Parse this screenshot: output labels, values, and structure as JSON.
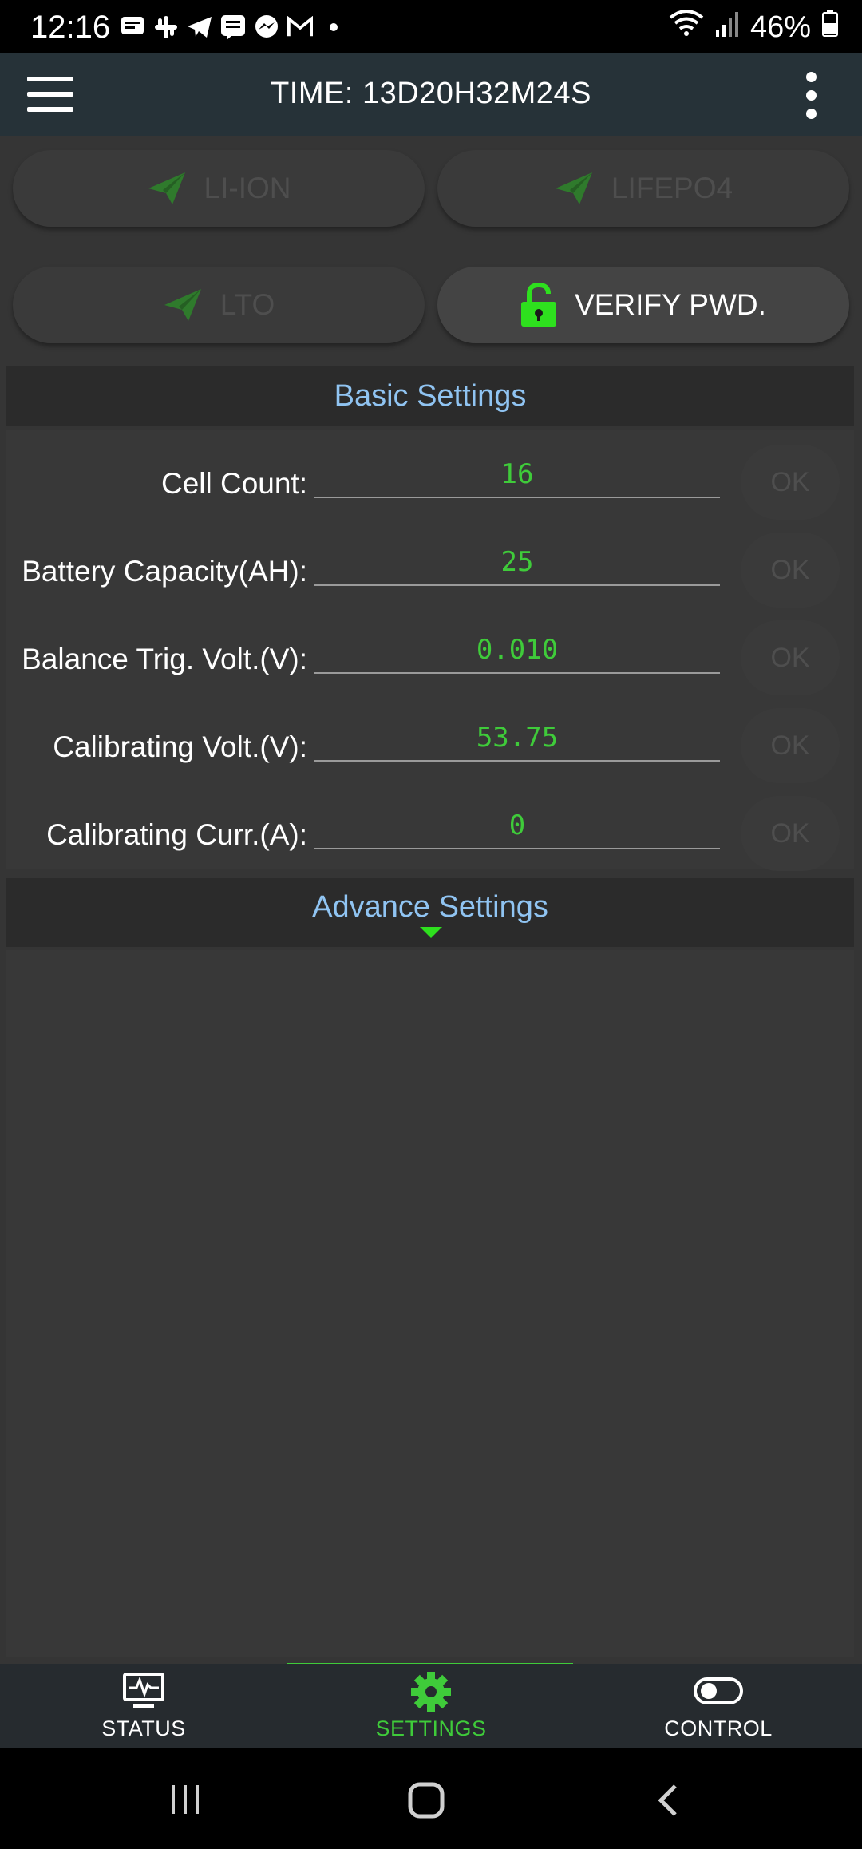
{
  "status_bar": {
    "time": "12:16",
    "battery_percent": "46%"
  },
  "app_bar": {
    "title": "TIME: 13D20H32M24S"
  },
  "presets": [
    {
      "label": "LI-ION"
    },
    {
      "label": "LIFEPO4"
    },
    {
      "label": "LTO"
    },
    {
      "label": "VERIFY PWD."
    }
  ],
  "basic_settings": {
    "header": "Basic Settings",
    "rows": [
      {
        "label": "Cell Count:",
        "value": "16",
        "ok": "OK"
      },
      {
        "label": "Battery Capacity(AH):",
        "value": "25",
        "ok": "OK"
      },
      {
        "label": "Balance Trig. Volt.(V):",
        "value": "0.010",
        "ok": "OK"
      },
      {
        "label": "Calibrating Volt.(V):",
        "value": "53.75",
        "ok": "OK"
      },
      {
        "label": "Calibrating Curr.(A):",
        "value": "0",
        "ok": "OK"
      }
    ]
  },
  "advance_settings": {
    "header": "Advance Settings"
  },
  "bottom_nav": [
    {
      "label": "STATUS"
    },
    {
      "label": "SETTINGS"
    },
    {
      "label": "CONTROL"
    }
  ],
  "colors": {
    "accent_green": "#3fcb3a",
    "header_blue": "#90c4f2",
    "app_bar": "#263238"
  }
}
